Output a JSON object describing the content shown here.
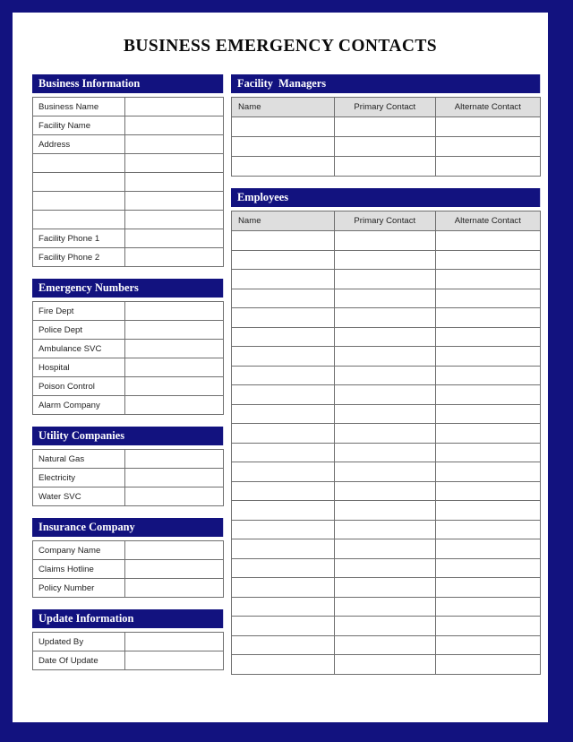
{
  "document": {
    "title": "BUSINESS EMERGENCY CONTACTS",
    "frame_color": "#12127f",
    "header_bar_color": "#12127f",
    "label_cell_color": "#dedede",
    "grid_line_color": "#6f6f6f"
  },
  "left_column": {
    "sections": [
      {
        "name": "business-information",
        "heading": "Business Information",
        "rows": [
          {
            "label": "Business Name",
            "value": ""
          },
          {
            "label": "Facility Name",
            "value": ""
          },
          {
            "label": "Address",
            "value": ""
          },
          {
            "label": "",
            "value": ""
          },
          {
            "label": "",
            "value": ""
          },
          {
            "label": "",
            "value": ""
          },
          {
            "label": "",
            "value": ""
          },
          {
            "label": "Facility Phone 1",
            "value": ""
          },
          {
            "label": "Facility Phone 2",
            "value": ""
          }
        ]
      },
      {
        "name": "emergency-numbers",
        "heading": "Emergency Numbers",
        "rows": [
          {
            "label": "Fire Dept",
            "value": ""
          },
          {
            "label": "Police Dept",
            "value": ""
          },
          {
            "label": "Ambulance SVC",
            "value": ""
          },
          {
            "label": "Hospital",
            "value": ""
          },
          {
            "label": "Poison Control",
            "value": ""
          },
          {
            "label": "Alarm Company",
            "value": ""
          }
        ]
      },
      {
        "name": "utility-companies",
        "heading": "Utility Companies",
        "rows": [
          {
            "label": "Natural Gas",
            "value": ""
          },
          {
            "label": "Electricity",
            "value": ""
          },
          {
            "label": "Water SVC",
            "value": ""
          }
        ]
      },
      {
        "name": "insurance-company",
        "heading": "Insurance Company",
        "rows": [
          {
            "label": "Company Name",
            "value": ""
          },
          {
            "label": "Claims Hotline",
            "value": ""
          },
          {
            "label": "Policy Number",
            "value": ""
          }
        ]
      },
      {
        "name": "update-information",
        "heading": "Update Information",
        "rows": [
          {
            "label": "Updated By",
            "value": ""
          },
          {
            "label": "Date Of Update",
            "value": ""
          }
        ]
      }
    ]
  },
  "right_column": {
    "sections": [
      {
        "name": "facility-managers",
        "heading": "Facility  Managers",
        "columns": [
          "Name",
          "Primary Contact",
          "Alternate Contact"
        ],
        "empty_row_count": 3,
        "rows": [
          [
            "",
            "",
            ""
          ],
          [
            "",
            "",
            ""
          ],
          [
            "",
            "",
            ""
          ]
        ]
      },
      {
        "name": "employees",
        "heading": "Employees",
        "columns": [
          "Name",
          "Primary Contact",
          "Alternate Contact"
        ],
        "empty_row_count": 23,
        "rows": [
          [
            "",
            "",
            ""
          ],
          [
            "",
            "",
            ""
          ],
          [
            "",
            "",
            ""
          ],
          [
            "",
            "",
            ""
          ],
          [
            "",
            "",
            ""
          ],
          [
            "",
            "",
            ""
          ],
          [
            "",
            "",
            ""
          ],
          [
            "",
            "",
            ""
          ],
          [
            "",
            "",
            ""
          ],
          [
            "",
            "",
            ""
          ],
          [
            "",
            "",
            ""
          ],
          [
            "",
            "",
            ""
          ],
          [
            "",
            "",
            ""
          ],
          [
            "",
            "",
            ""
          ],
          [
            "",
            "",
            ""
          ],
          [
            "",
            "",
            ""
          ],
          [
            "",
            "",
            ""
          ],
          [
            "",
            "",
            ""
          ],
          [
            "",
            "",
            ""
          ],
          [
            "",
            "",
            ""
          ],
          [
            "",
            "",
            ""
          ],
          [
            "",
            "",
            ""
          ],
          [
            "",
            "",
            ""
          ]
        ]
      }
    ]
  }
}
